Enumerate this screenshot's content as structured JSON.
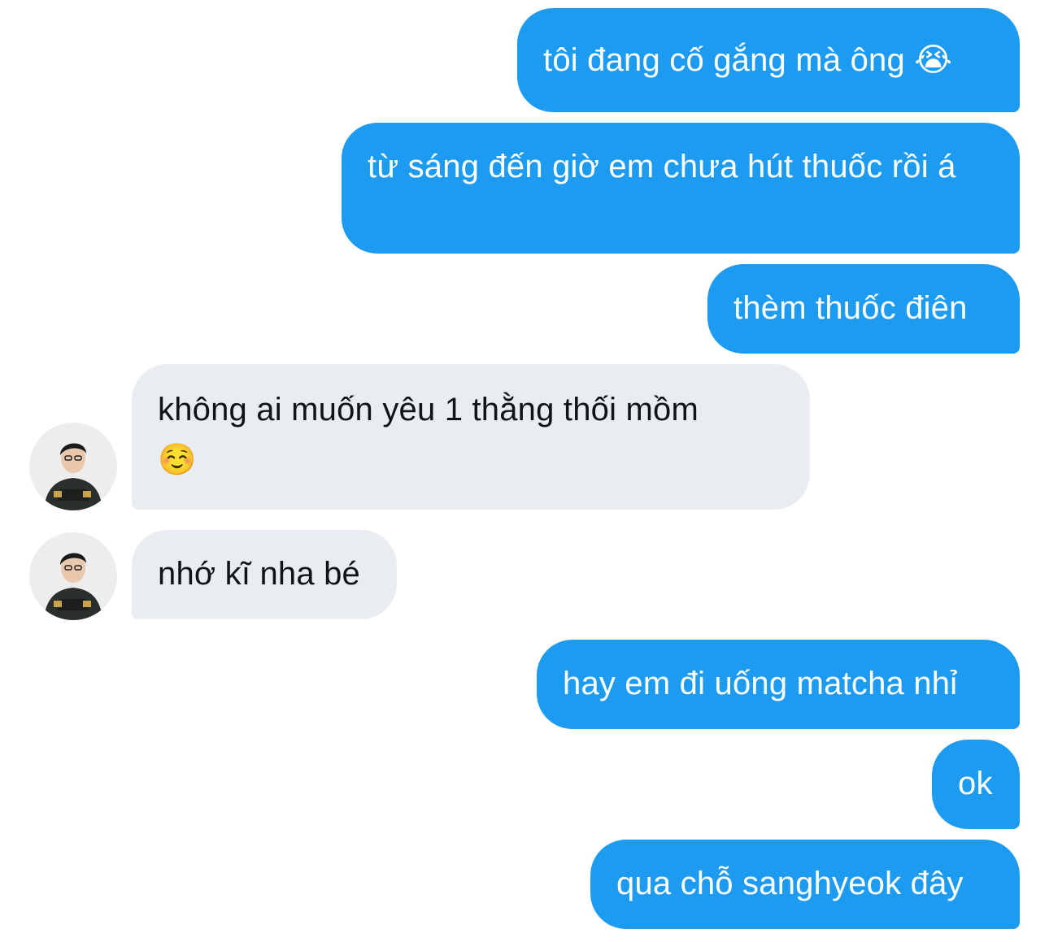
{
  "chat": {
    "messages": [
      {
        "sender": "me",
        "text": "tôi đang cố gắng mà ông 😭"
      },
      {
        "sender": "me",
        "text": "từ sáng đến giờ em chưa hút thuốc rồi á"
      },
      {
        "sender": "me",
        "text": "thèm thuốc điên"
      },
      {
        "sender": "them",
        "text": "không ai muốn yêu 1 thằng thối mồm",
        "emoji": "☺️"
      },
      {
        "sender": "them",
        "text": "nhớ kĩ nha bé"
      },
      {
        "sender": "me",
        "text": "hay em đi uống matcha nhỉ"
      },
      {
        "sender": "me",
        "text": "ok"
      },
      {
        "sender": "me",
        "text": "qua chỗ sanghyeok đây"
      }
    ]
  },
  "colors": {
    "sent_bubble": "#1d9bf0",
    "received_bubble": "#e9edf1",
    "sent_text": "#ffffff",
    "received_text": "#0f1419"
  },
  "icons": {
    "avatar": "contact-avatar"
  }
}
